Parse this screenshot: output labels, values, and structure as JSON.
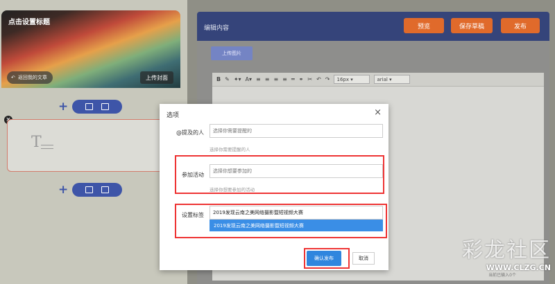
{
  "left": {
    "cover_title": "点击设置标题",
    "back_label": "返回我的文章",
    "upload_cover_label": "上传封面"
  },
  "right": {
    "title": "编辑内容",
    "preview_label": "预览",
    "save_draft_label": "保存草稿",
    "publish_label": "发布",
    "upload_image_label": "上传图片",
    "font_size": "16px",
    "font_family": "arial",
    "word_count": "当前已输入0个"
  },
  "dialog": {
    "title": "选项",
    "mention_label": "@提及的人",
    "mention_placeholder": "选择你需要提醒的",
    "mention_hint": "选择你需要提醒的人",
    "activity_label": "参加活动",
    "activity_placeholder": "选择你想要参加的",
    "activity_hint": "选择你想要参加的活动",
    "tag_label": "设置标签",
    "tag_value": "2019发现云南之美网络摄影暨短视频大赛",
    "tag_option": "2019发现云南之美网络摄影暨短视频大赛",
    "confirm_label": "确认发布",
    "cancel_label": "取消"
  },
  "watermark": {
    "text": "彩龙社区",
    "url": "WWW.CLZG.CN"
  },
  "colors": {
    "header": "#35447a",
    "accent": "#e06a2b",
    "primary": "#2f86de",
    "highlight": "#e33333"
  }
}
